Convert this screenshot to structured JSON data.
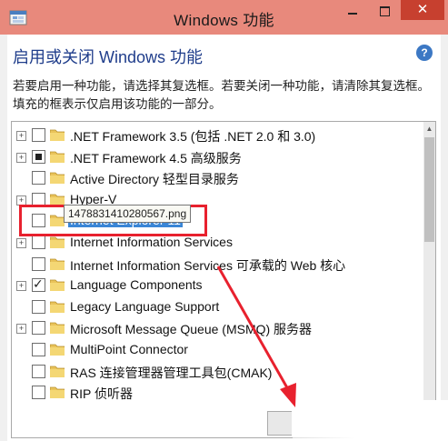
{
  "window": {
    "title": "Windows 功能",
    "close_glyph": "✕",
    "app_icon": "windows-features-icon"
  },
  "heading": "启用或关闭 Windows 功能",
  "help_glyph": "?",
  "description": "若要启用一种功能，请选择其复选框。若要关闭一种功能，请清除其复选框。填充的框表示仅启用该功能的一部分。",
  "features": [
    {
      "label": ".NET Framework 3.5 (包括 .NET 2.0 和 3.0)",
      "expandable": true,
      "state": "unchecked",
      "selected": false
    },
    {
      "label": ".NET Framework 4.5 高级服务",
      "expandable": true,
      "state": "partial",
      "selected": false
    },
    {
      "label": "Active Directory 轻型目录服务",
      "expandable": false,
      "state": "unchecked",
      "selected": false
    },
    {
      "label": "Hyper-V",
      "expandable": true,
      "state": "unchecked",
      "selected": false
    },
    {
      "label": "Internet Explorer 11",
      "expandable": false,
      "state": "unchecked",
      "selected": true
    },
    {
      "label": "Internet Information Services",
      "expandable": true,
      "state": "unchecked",
      "selected": false
    },
    {
      "label": "Internet Information Services 可承载的 Web 核心",
      "expandable": false,
      "state": "unchecked",
      "selected": false
    },
    {
      "label": "Language Components",
      "expandable": true,
      "state": "checked",
      "selected": false
    },
    {
      "label": "Legacy Language Support",
      "expandable": false,
      "state": "unchecked",
      "selected": false
    },
    {
      "label": "Microsoft Message Queue (MSMQ) 服务器",
      "expandable": true,
      "state": "unchecked",
      "selected": false
    },
    {
      "label": "MultiPoint Connector",
      "expandable": false,
      "state": "unchecked",
      "selected": false
    },
    {
      "label": "RAS 连接管理器管理工具包(CMAK)",
      "expandable": false,
      "state": "unchecked",
      "selected": false
    },
    {
      "label": "RIP 侦听器",
      "expandable": false,
      "state": "unchecked",
      "selected": false
    }
  ],
  "tooltip": "1478831410280567.png",
  "colors": {
    "title_bar": "#e8897c",
    "close_button": "#c7402f",
    "heading_text": "#1f3d8b",
    "selection": "#3a86d6",
    "annotation_red": "#e8212e"
  }
}
